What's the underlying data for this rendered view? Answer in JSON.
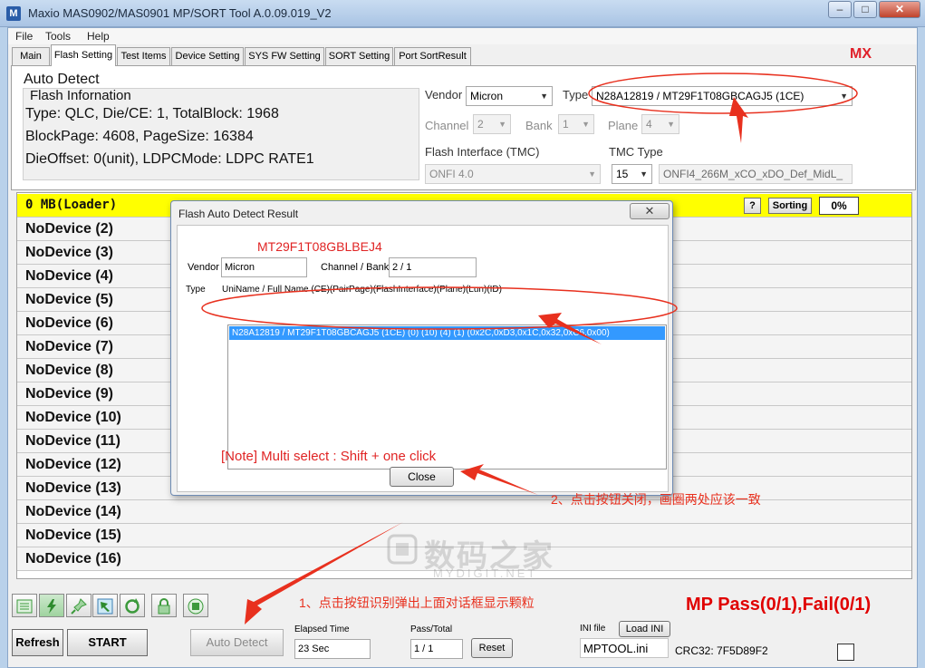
{
  "window": {
    "title": "Maxio MAS0902/MAS0901 MP/SORT Tool A.0.09.019_V2",
    "controls": [
      "‒",
      "□",
      "✕"
    ]
  },
  "menu": [
    "File",
    "Tools",
    "Help"
  ],
  "tabs": [
    "Main",
    "Flash Setting",
    "Test Items",
    "Device Setting",
    "SYS FW Setting",
    "SORT Setting",
    "Port SortResult"
  ],
  "active_tab": "Flash Setting",
  "brand_tag": "MX",
  "auto_detect": {
    "group_title": "Auto Detect",
    "info_title": "Flash Infornation",
    "lines": [
      "Type: QLC, Die/CE: 1, TotalBlock: 1968",
      "BlockPage: 4608, PageSize: 16384",
      "DieOffset: 0(unit), LDPCMode: LDPC RATE1"
    ],
    "vendor_label": "Vendor",
    "vendor": "Micron",
    "type_label": "Type",
    "type": "N28A12819  /  MT29F1T08GBCAGJ5 (1CE)",
    "channel_label": "Channel",
    "channel": "2",
    "bank_label": "Bank",
    "bank": "1",
    "plane_label": "Plane",
    "plane": "4",
    "interface_label": "Flash Interface (TMC)",
    "interface": "ONFI 4.0",
    "tmc_label": "TMC Type",
    "tmc": "15",
    "tmc_desc": "ONFI4_266M_xCO_xDO_Def_MidL_"
  },
  "devices": {
    "loader": "0 MB(Loader)",
    "help_button": "?",
    "sorting_button": "Sorting",
    "progress": "0%",
    "rows": [
      "NoDevice (2)",
      "NoDevice (3)",
      "NoDevice (4)",
      "NoDevice (5)",
      "NoDevice (6)",
      "NoDevice (7)",
      "NoDevice (8)",
      "NoDevice (9)",
      "NoDevice (10)",
      "NoDevice (11)",
      "NoDevice (12)",
      "NoDevice (13)",
      "NoDevice (14)",
      "NoDevice (15)",
      "NoDevice (16)"
    ]
  },
  "dialog": {
    "title": "Flash Auto Detect Result",
    "close_x": "✕",
    "part_number": "MT29F1T08GBLBEJ4",
    "vendor_label": "Vendor",
    "vendor": "Micron",
    "chbank_label": "Channel / Bank",
    "chbank": "2 / 1",
    "type_label": "Type",
    "type_header": "UniName / Full Name (CE)(PairPage)(FlashInterface)(Plane)(Lun)(ID)",
    "entries": [
      "N28A12819  /  MT29F1T08GBCAGJ5 (1CE) (0) (10) (4) (1) (0x2C,0xD3,0x1C,0x32,0xC6,0x00)"
    ],
    "note": "[Note] Multi select : Shift + one click",
    "close_button": "Close"
  },
  "bottom": {
    "status": "MP   Pass(0/1),Fail(0/1)",
    "refresh": "Refresh",
    "start": "START",
    "auto_detect": "Auto Detect",
    "elapsed_label": "Elapsed Time",
    "elapsed": "23 Sec",
    "passtotal_label": "Pass/Total",
    "passtotal": "1 / 1",
    "reset": "Reset",
    "ini_label": "INI file",
    "load_ini": "Load INI",
    "ini_file": "MPTOOL.ini",
    "crc": "CRC32: 7F5D89F2"
  },
  "toolbar_icons": [
    "list-icon",
    "flash-icon",
    "pin-icon",
    "arrow-icon",
    "refresh-icon",
    "lock-icon",
    "stop-icon"
  ],
  "annotations": {
    "note1": "1、点击按钮识别弹出上面对话框显示颗粒",
    "note2": "2、点击按钮关闭，画圈两处应该一致",
    "watermark": "数码之家",
    "watermark_sub": "MYDIGIT.NET"
  },
  "colors": {
    "annotation": "#e8301e",
    "loader_row": "#ffff00",
    "selection": "#3399ff",
    "status_red": "#e00000"
  }
}
